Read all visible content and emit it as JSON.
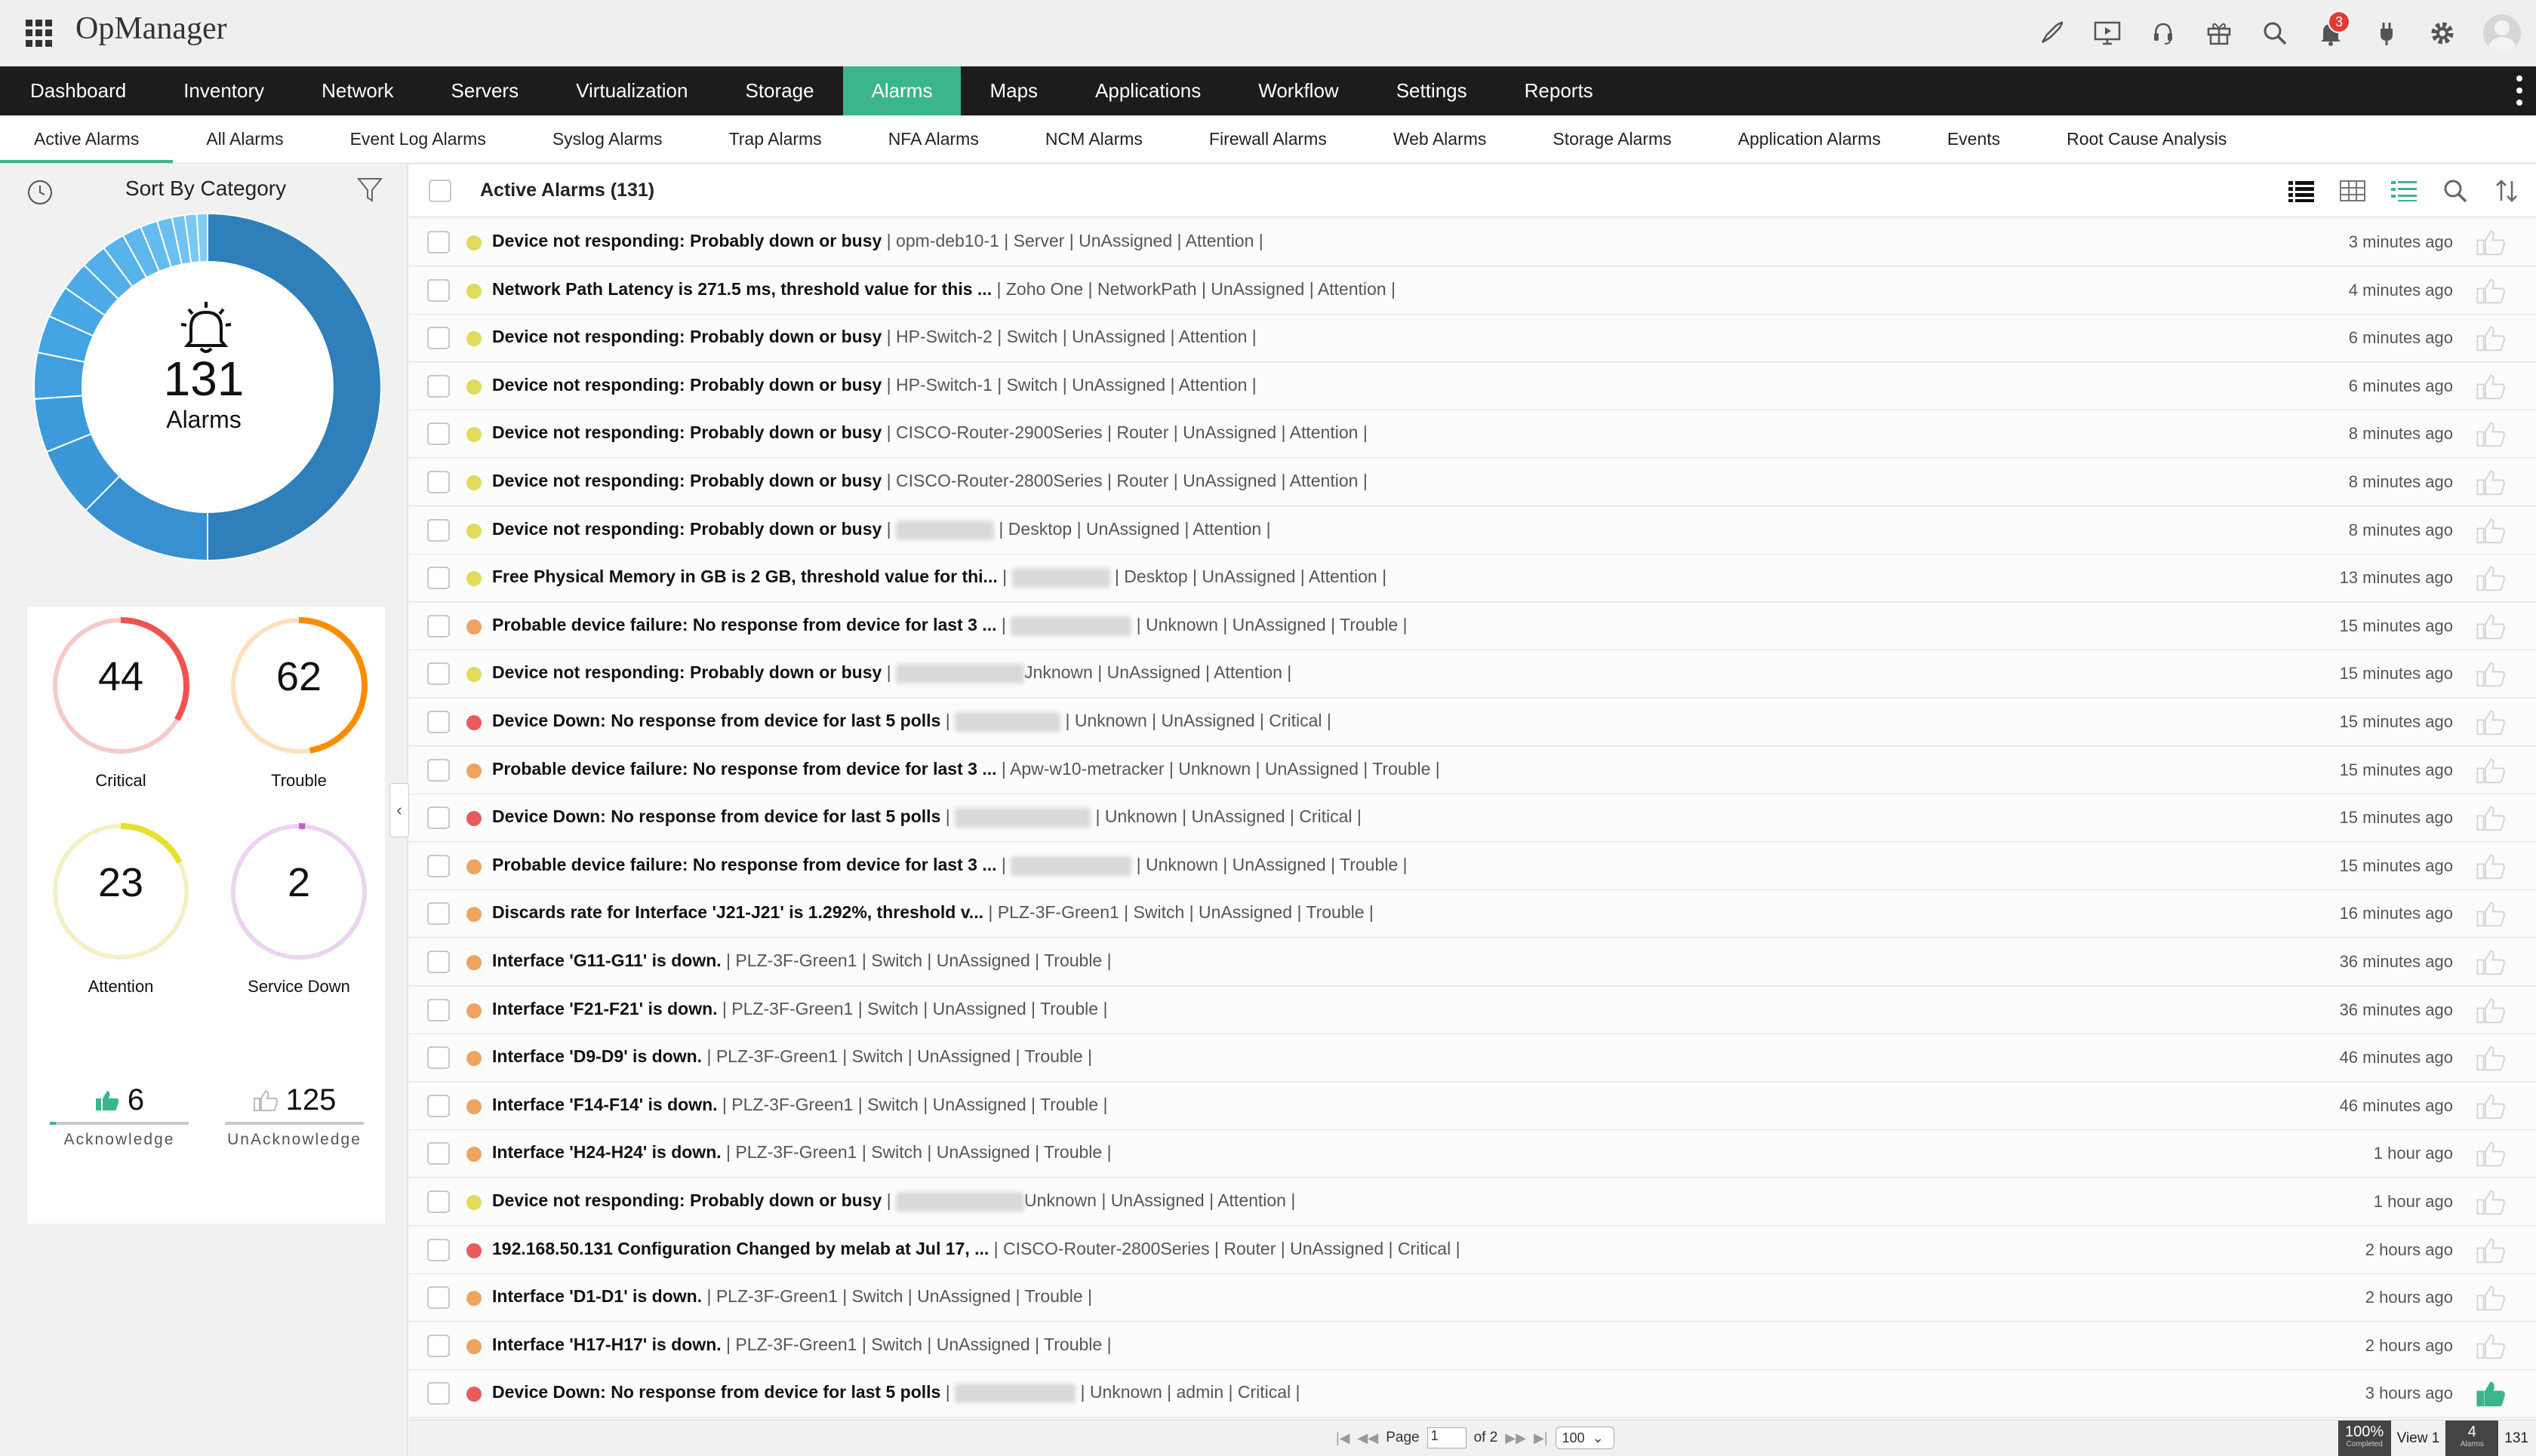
{
  "app": {
    "title": "OpManager",
    "notification_count": "3"
  },
  "top_icons": [
    "rocket-icon",
    "presentation-icon",
    "support-icon",
    "gift-icon",
    "search-icon",
    "bell-icon",
    "plug-icon",
    "gear-icon",
    "user-avatar"
  ],
  "main_nav": [
    "Dashboard",
    "Inventory",
    "Network",
    "Servers",
    "Virtualization",
    "Storage",
    "Alarms",
    "Maps",
    "Applications",
    "Workflow",
    "Settings",
    "Reports"
  ],
  "main_nav_active": "Alarms",
  "sub_nav": [
    "Active Alarms",
    "All Alarms",
    "Event Log Alarms",
    "Syslog Alarms",
    "Trap Alarms",
    "NFA Alarms",
    "NCM Alarms",
    "Firewall Alarms",
    "Web Alarms",
    "Storage Alarms",
    "Application Alarms",
    "Events",
    "Root Cause Analysis"
  ],
  "sub_nav_active": "Active Alarms",
  "left_panel": {
    "title": "Sort By Category",
    "total": "131",
    "total_label": "Alarms",
    "severities": [
      {
        "count": "44",
        "label": "Critical",
        "color": "#ef5350",
        "track": "#f7caca",
        "fraction": 0.336
      },
      {
        "count": "62",
        "label": "Trouble",
        "color": "#fb8c00",
        "track": "#ffe0bd",
        "fraction": 0.473
      },
      {
        "count": "23",
        "label": "Attention",
        "color": "#e6e02e",
        "track": "#f3f1c6",
        "fraction": 0.176
      },
      {
        "count": "2",
        "label": "Service Down",
        "color": "#ba68c8",
        "track": "#ecd4f1",
        "fraction": 0.015
      }
    ],
    "acknowledge": {
      "count": "6",
      "label": "Acknowledge",
      "fraction": 0.046
    },
    "unacknowledge": {
      "count": "125",
      "label": "UnAcknowledge",
      "fraction": 0.954
    }
  },
  "list": {
    "title": "Active Alarms (131)",
    "rows": [
      {
        "severity": "attention",
        "msg": "Device not responding: Probably down or busy",
        "meta": " | opm-deb10-1 | Server | UnAssigned | Attention |",
        "time": "3 minutes ago",
        "ack": false
      },
      {
        "severity": "attention",
        "msg": "Network Path Latency is 271.5 ms, threshold value for this ...",
        "meta": " | Zoho One | NetworkPath | UnAssigned | Attention |",
        "time": "4 minutes ago",
        "ack": false
      },
      {
        "severity": "attention",
        "msg": "Device not responding: Probably down or busy",
        "meta": " | HP-Switch-2 | Switch | UnAssigned | Attention |",
        "time": "6 minutes ago",
        "ack": false
      },
      {
        "severity": "attention",
        "msg": "Device not responding: Probably down or busy",
        "meta": " | HP-Switch-1 | Switch | UnAssigned | Attention |",
        "time": "6 minutes ago",
        "ack": false
      },
      {
        "severity": "attention",
        "msg": "Device not responding: Probably down or busy",
        "meta": " | CISCO-Router-2900Series | Router | UnAssigned | Attention |",
        "time": "8 minutes ago",
        "ack": false
      },
      {
        "severity": "attention",
        "msg": "Device not responding: Probably down or busy",
        "meta": " | CISCO-Router-2800Series | Router | UnAssigned | Attention |",
        "time": "8 minutes ago",
        "ack": false
      },
      {
        "severity": "attention",
        "msg": "Device not responding: Probably down or busy",
        "meta": " | Desktop | UnAssigned | Attention |",
        "time": "8 minutes ago",
        "ack": false,
        "blur": 130
      },
      {
        "severity": "attention",
        "msg": "Free Physical Memory in GB is 2 GB, threshold value for thi...",
        "meta": " | Desktop | UnAssigned | Attention |",
        "time": "13 minutes ago",
        "ack": false,
        "blur": 130
      },
      {
        "severity": "trouble",
        "msg": "Probable device failure: No response from device for last 3 ...",
        "meta": " | Unknown | UnAssigned | Trouble |",
        "time": "15 minutes ago",
        "ack": false,
        "blur": 160
      },
      {
        "severity": "attention",
        "msg": "Device not responding: Probably down or busy",
        "meta": "Jnknown | UnAssigned | Attention |",
        "time": "15 minutes ago",
        "ack": false,
        "blur": 170
      },
      {
        "severity": "critical",
        "msg": "Device Down: No response from device for last 5 polls",
        "meta": " | Unknown | UnAssigned | Critical |",
        "time": "15 minutes ago",
        "ack": false,
        "blur": 140
      },
      {
        "severity": "trouble",
        "msg": "Probable device failure: No response from device for last 3 ...",
        "meta": " | Apw-w10-metracker | Unknown | UnAssigned | Trouble |",
        "time": "15 minutes ago",
        "ack": false
      },
      {
        "severity": "critical",
        "msg": "Device Down: No response from device for last 5 polls",
        "meta": " | Unknown | UnAssigned | Critical |",
        "time": "15 minutes ago",
        "ack": false,
        "blur": 180
      },
      {
        "severity": "trouble",
        "msg": "Probable device failure: No response from device for last 3 ...",
        "meta": " | Unknown | UnAssigned | Trouble |",
        "time": "15 minutes ago",
        "ack": false,
        "blur": 160
      },
      {
        "severity": "trouble",
        "msg": "Discards rate for Interface 'J21-J21' is 1.292%, threshold v...",
        "meta": "  | PLZ-3F-Green1 | Switch | UnAssigned | Trouble |",
        "time": "16 minutes ago",
        "ack": false
      },
      {
        "severity": "trouble",
        "msg": "Interface 'G11-G11' is down.",
        "meta": " | PLZ-3F-Green1 | Switch | UnAssigned | Trouble |",
        "time": "36 minutes ago",
        "ack": false
      },
      {
        "severity": "trouble",
        "msg": "Interface 'F21-F21' is down.",
        "meta": " | PLZ-3F-Green1 | Switch | UnAssigned | Trouble |",
        "time": "36 minutes ago",
        "ack": false
      },
      {
        "severity": "trouble",
        "msg": "Interface 'D9-D9' is down.",
        "meta": " | PLZ-3F-Green1 | Switch | UnAssigned | Trouble |",
        "time": "46 minutes ago",
        "ack": false
      },
      {
        "severity": "trouble",
        "msg": "Interface 'F14-F14' is down.",
        "meta": " | PLZ-3F-Green1 | Switch | UnAssigned | Trouble |",
        "time": "46 minutes ago",
        "ack": false
      },
      {
        "severity": "trouble",
        "msg": "Interface 'H24-H24' is down.",
        "meta": " | PLZ-3F-Green1 | Switch | UnAssigned | Trouble |",
        "time": "1 hour ago",
        "ack": false
      },
      {
        "severity": "attention",
        "msg": "Device not responding: Probably down or busy",
        "meta": "Unknown | UnAssigned | Attention |",
        "time": "1 hour ago",
        "ack": false,
        "blur": 170
      },
      {
        "severity": "critical",
        "msg": "192.168.50.131 Configuration Changed by melab at Jul 17, ...",
        "meta": " | CISCO-Router-2800Series | Router | UnAssigned | Critical |",
        "time": "2 hours ago",
        "ack": false
      },
      {
        "severity": "trouble",
        "msg": "Interface 'D1-D1' is down.",
        "meta": " | PLZ-3F-Green1 | Switch | UnAssigned | Trouble |",
        "time": "2 hours ago",
        "ack": false
      },
      {
        "severity": "trouble",
        "msg": "Interface 'H17-H17' is down.",
        "meta": " | PLZ-3F-Green1 | Switch | UnAssigned | Trouble |",
        "time": "2 hours ago",
        "ack": false
      },
      {
        "severity": "critical",
        "msg": "Device Down: No response from device for last 5 polls",
        "meta": " | Unknown | admin | Critical |",
        "time": "3 hours ago",
        "ack": true,
        "blur": 160
      }
    ]
  },
  "severity_colors": {
    "critical": "#e85b5b",
    "trouble": "#f0a35e",
    "attention": "#dedc5a"
  },
  "pager": {
    "page_label": "Page",
    "page_value": "1",
    "of_label": "of 2",
    "per_page": "100",
    "completed_pct": "100%",
    "completed_label": "Completed",
    "view_label": "View 1",
    "alarms_count": "4",
    "alarms_label": "Alarms",
    "total": "131"
  }
}
